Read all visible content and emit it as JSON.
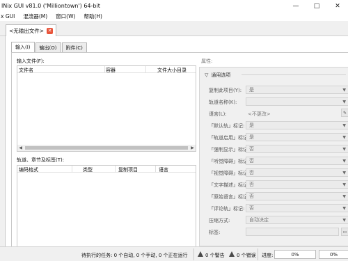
{
  "window": {
    "title": "lNix GUI v81.0 ('Milliontown') 64-bit",
    "minimize_icon": "—",
    "maximize_icon": "□",
    "close_icon": "✕"
  },
  "menu": [
    "x GUI",
    "混流器(M)",
    "窗口(W)",
    "帮助(H)"
  ],
  "file_tab": {
    "label": "<无输出文件>",
    "close_symbol": "✕"
  },
  "tabs": [
    "输入(I)",
    "输出(O)",
    "附件(C)"
  ],
  "input": {
    "section_label": "输入文件(F):",
    "columns": [
      "文件名",
      "容器",
      "文件大小",
      "目录"
    ]
  },
  "tracks": {
    "section_label": "轨道、章节及标签(T):",
    "columns": [
      "编码格式",
      "类型",
      "复制项目",
      "语言"
    ]
  },
  "properties": {
    "section_label": "属性:",
    "group_label": "通用选项",
    "rows": [
      {
        "label": "复制此项目(Y):",
        "value": "是",
        "kind": "select"
      },
      {
        "label": "轨道名称(K):",
        "value": "",
        "kind": "select"
      },
      {
        "label": "语言(L):",
        "value": "<不更改>",
        "kind": "text",
        "side_button": true
      },
      {
        "label": "「默认轨」标记:",
        "value": "是",
        "kind": "select"
      },
      {
        "label": "「轨道启用」标记:",
        "value": "是",
        "kind": "select"
      },
      {
        "label": "「强制显示」标记:",
        "value": "否",
        "kind": "select"
      },
      {
        "label": "「听觉障碍」标记:",
        "value": "否",
        "kind": "select"
      },
      {
        "label": "「视觉障碍」标记:",
        "value": "否",
        "kind": "select"
      },
      {
        "label": "「文字描述」标记:",
        "value": "否",
        "kind": "select"
      },
      {
        "label": "「原始语言」标记:",
        "value": "否",
        "kind": "select"
      },
      {
        "label": "「评论轨」标记:",
        "value": "否",
        "kind": "select"
      },
      {
        "label": "压缩方式:",
        "value": "自动决定",
        "kind": "select"
      },
      {
        "label": "标签:",
        "value": "",
        "kind": "select",
        "side_button": true
      }
    ]
  },
  "status": {
    "pending": "待执行的任务: 0 个自动, 0 个手动, 0 个正在运行",
    "warnings": "0 个警告",
    "errors": "0 个错误",
    "progress_label": "进度:",
    "progress1": "0%",
    "progress2": "0%"
  }
}
